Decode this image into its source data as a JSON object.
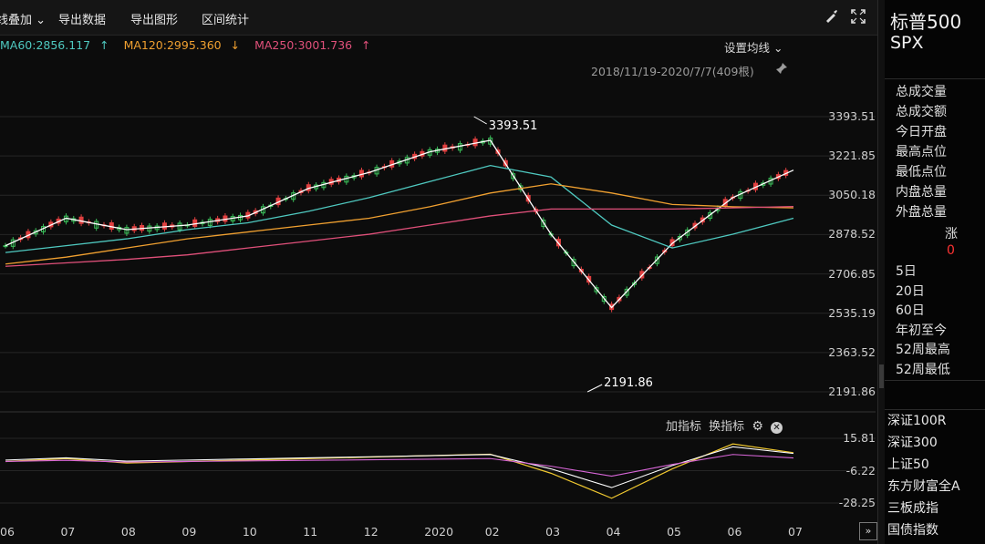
{
  "toolbar": {
    "overlay_label": "线叠加",
    "export_data": "导出数据",
    "export_chart": "导出图形",
    "range_stats": "区间统计"
  },
  "ma": {
    "ma60": "MA60:2856.117",
    "ma60_arrow": "↑",
    "ma120": "MA120:2995.360",
    "ma120_arrow": "↓",
    "ma250": "MA250:3001.736",
    "ma250_arrow": "↑",
    "set_ma": "设置均线",
    "colors": {
      "ma60": "#4fc9c0",
      "ma120": "#f0a030",
      "ma250": "#e0507a",
      "ma5": "#ffffff",
      "ma20": "#d866d8"
    }
  },
  "range_label": "2018/11/19-2020/7/7(409根)",
  "price_axis": [
    "3393.51",
    "3221.85",
    "3050.18",
    "2878.52",
    "2706.85",
    "2535.19",
    "2363.52",
    "2191.86"
  ],
  "annotations": {
    "high": "3393.51",
    "low": "2191.86"
  },
  "time_axis": [
    "06",
    "07",
    "08",
    "09",
    "10",
    "11",
    "12",
    "2020",
    "02",
    "03",
    "04",
    "05",
    "06",
    "07"
  ],
  "sub_chart": {
    "add_indicator": "加指标",
    "switch_indicator": "换指标",
    "axis": [
      "15.81",
      "-6.22",
      "-28.25"
    ]
  },
  "panel": {
    "title": "标普500",
    "code": "SPX",
    "stats": [
      "总成交量",
      "总成交额",
      "今日开盘",
      "最高点位",
      "最低点位",
      "内盘总量",
      "外盘总量"
    ],
    "change_label": "涨",
    "change_value": "0",
    "periods": [
      "5日",
      "20日",
      "60日",
      "年初至今",
      "52周最高",
      "52周最低"
    ],
    "indices": [
      "深证100R",
      "深证300",
      "上证50",
      "东方财富全A",
      "三板成指",
      "国债指数"
    ]
  },
  "chart_data": {
    "type": "line",
    "title": "",
    "xlabel": "",
    "ylabel": "",
    "x": [
      "06",
      "07",
      "08",
      "09",
      "10",
      "11",
      "12",
      "2020",
      "02",
      "03",
      "04",
      "05",
      "06",
      "07"
    ],
    "ylim": [
      2191.86,
      3393.51
    ],
    "series": [
      {
        "name": "",
        "values": [
          2830,
          2950,
          2900,
          2920,
          2960,
          3080,
          3150,
          3240,
          3290,
          2880,
          2560,
          2840,
          3040,
          3160
        ]
      },
      {
        "name": "MA60",
        "values": [
          2800,
          2830,
          2860,
          2900,
          2930,
          2980,
          3040,
          3110,
          3180,
          3130,
          2920,
          2820,
          2880,
          2950
        ]
      },
      {
        "name": "MA120",
        "values": [
          2750,
          2780,
          2820,
          2860,
          2890,
          2920,
          2950,
          3000,
          3060,
          3100,
          3060,
          3010,
          3000,
          2995
        ]
      },
      {
        "name": "MA250",
        "values": [
          2740,
          2755,
          2770,
          2790,
          2820,
          2850,
          2880,
          2920,
          2960,
          2990,
          2990,
          2990,
          2995,
          3001
        ]
      }
    ],
    "sub_series": {
      "ylim": [
        -28.25,
        15.81
      ],
      "values": [
        0,
        2,
        -1,
        0,
        1,
        2,
        3,
        4,
        5,
        -8,
        -25,
        -5,
        12,
        6
      ]
    }
  }
}
